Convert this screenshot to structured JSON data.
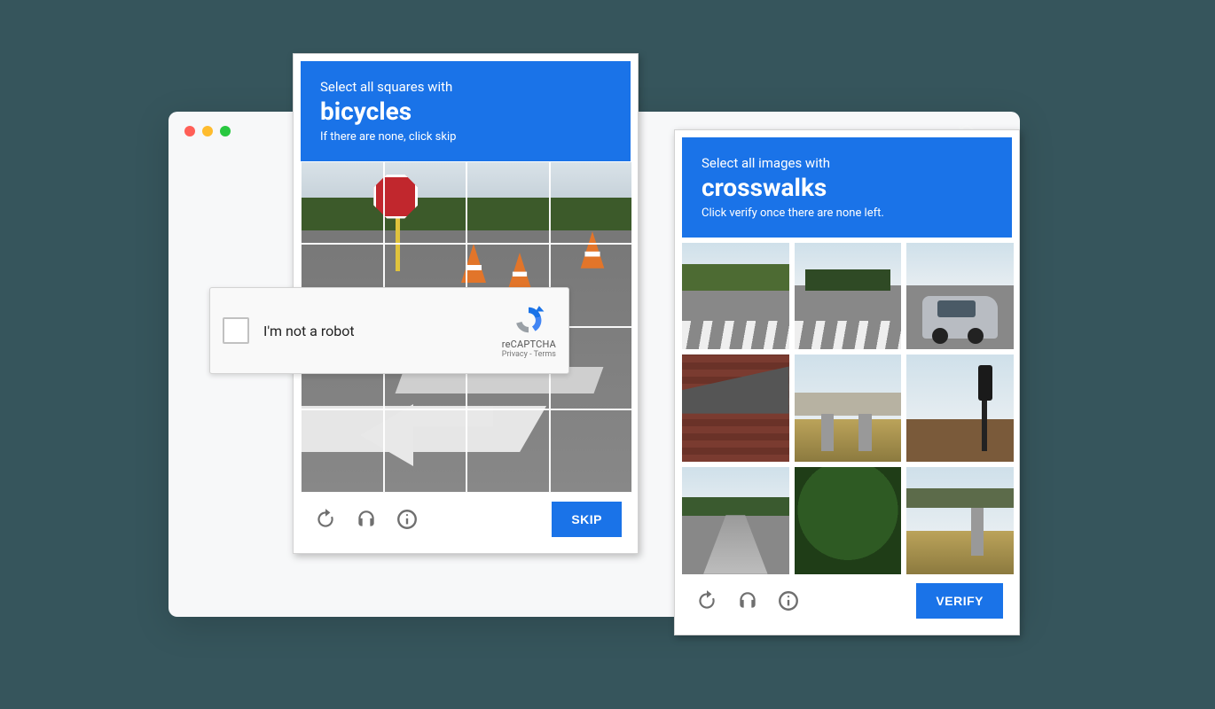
{
  "captcha_left": {
    "instruction_line1": "Select all squares with",
    "target": "bicycles",
    "instruction_line3": "If there are none, click skip",
    "action_button": "SKIP"
  },
  "captcha_right": {
    "instruction_line1": "Select all images with",
    "target": "crosswalks",
    "instruction_line3": "Click verify once there are none left.",
    "action_button": "VERIFY"
  },
  "robot_widget": {
    "label": "I'm not a robot",
    "badge_name": "reCAPTCHA",
    "privacy": "Privacy",
    "terms": "Terms",
    "sep": " - "
  },
  "icons": {
    "reload": "reload-icon",
    "audio": "headphones-icon",
    "info": "info-icon"
  }
}
